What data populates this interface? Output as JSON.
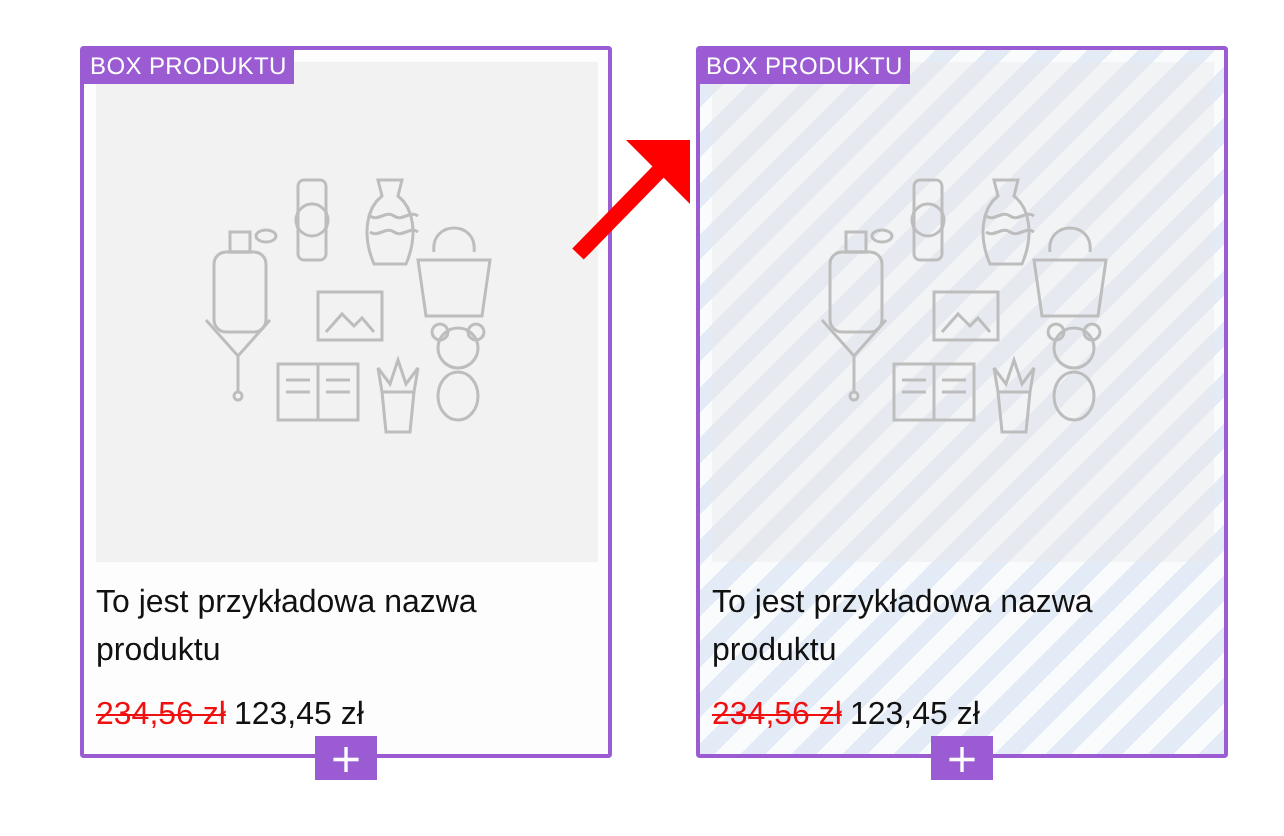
{
  "cards": [
    {
      "tag": "BOX PRODUKTU",
      "highlighted": false,
      "name": "To jest przykładowa nazwa produktu",
      "old_price": "234,56 zł",
      "price": "123,45 zł",
      "add_button": "+"
    },
    {
      "tag": "BOX PRODUKTU",
      "highlighted": true,
      "name": "To jest przykładowa nazwa produktu",
      "old_price": "234,56 zł",
      "price": "123,45 zł",
      "add_button": "+"
    }
  ]
}
